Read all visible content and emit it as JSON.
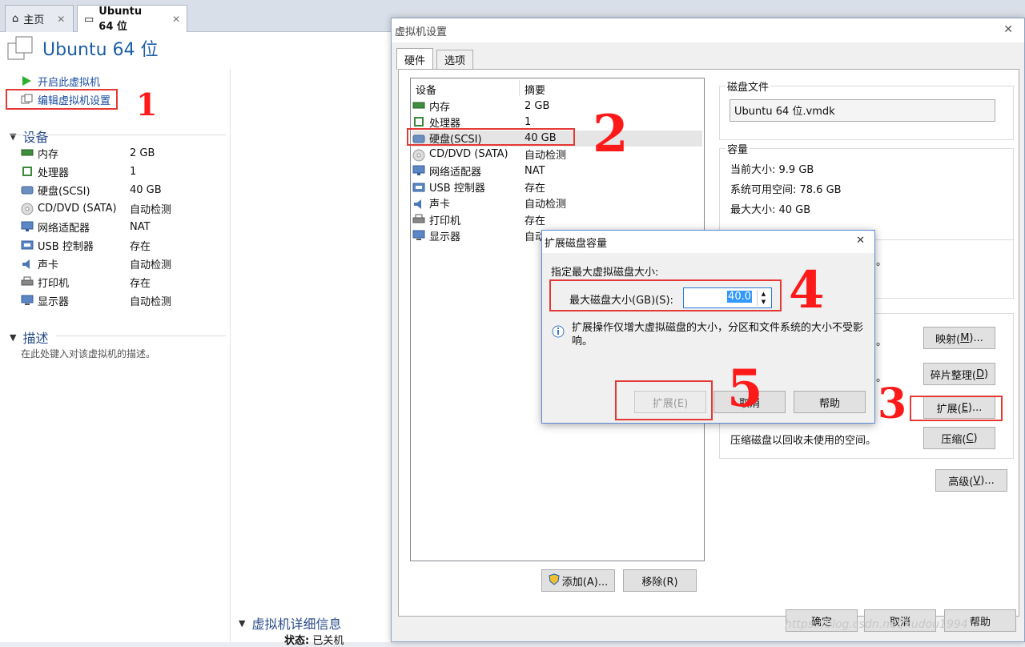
{
  "tabs": [
    {
      "label": "主页",
      "icon": "home-icon",
      "close": "✕"
    },
    {
      "label": "Ubuntu 64 位",
      "icon": "vm-icon",
      "close": "✕"
    }
  ],
  "vm_title": "Ubuntu 64 位",
  "left": {
    "actions": [
      {
        "label": "开启此虚拟机",
        "icon": "play-icon"
      },
      {
        "label": "编辑虚拟机设置",
        "icon": "edit-settings-icon"
      }
    ],
    "devices_section": "设备",
    "devices": [
      {
        "name": "内存",
        "value": "2 GB",
        "icon": "memory-icon"
      },
      {
        "name": "处理器",
        "value": "1",
        "icon": "processor-icon"
      },
      {
        "name": "硬盘(SCSI)",
        "value": "40 GB",
        "icon": "hard-disk-icon"
      },
      {
        "name": "CD/DVD (SATA)",
        "value": "自动检测",
        "icon": "cd-dvd-icon"
      },
      {
        "name": "网络适配器",
        "value": "NAT",
        "icon": "network-icon"
      },
      {
        "name": "USB 控制器",
        "value": "存在",
        "icon": "usb-icon"
      },
      {
        "name": "声卡",
        "value": "自动检测",
        "icon": "sound-icon"
      },
      {
        "name": "打印机",
        "value": "存在",
        "icon": "printer-icon"
      },
      {
        "name": "显示器",
        "value": "自动检测",
        "icon": "display-icon"
      }
    ],
    "desc_section": "描述",
    "desc_placeholder": "在此处键入对该虚拟机的描述。",
    "details_section": "虚拟机详细信息",
    "status_label": "状态:",
    "status_value": "已关机"
  },
  "settings": {
    "title": "虚拟机设置",
    "close": "✕",
    "tabs": [
      "硬件",
      "选项"
    ],
    "col_device": "设备",
    "col_summary": "摘要",
    "devices": [
      {
        "name": "内存",
        "value": "2 GB",
        "icon": "memory-icon"
      },
      {
        "name": "处理器",
        "value": "1",
        "icon": "processor-icon"
      },
      {
        "name": "硬盘(SCSI)",
        "value": "40 GB",
        "icon": "hard-disk-icon"
      },
      {
        "name": "CD/DVD (SATA)",
        "value": "自动检测",
        "icon": "cd-dvd-icon"
      },
      {
        "name": "网络适配器",
        "value": "NAT",
        "icon": "network-icon"
      },
      {
        "name": "USB 控制器",
        "value": "存在",
        "icon": "usb-icon"
      },
      {
        "name": "声卡",
        "value": "自动检测",
        "icon": "sound-icon"
      },
      {
        "name": "打印机",
        "value": "存在",
        "icon": "printer-icon"
      },
      {
        "name": "显示器",
        "value": "自动检",
        "icon": "display-icon"
      }
    ],
    "add_label": "添加(A)...",
    "remove_label": "移除(R)",
    "disk_file_title": "磁盘文件",
    "disk_file_value": "Ubuntu 64 位.vmdk",
    "capacity_title": "容量",
    "current_size": "当前大小: 9.9 GB",
    "free_space": "系统可用空间: 78.6 GB",
    "max_size": "最大大小: 40 GB",
    "dot1": "。",
    "dot2": "。",
    "dot3": "。",
    "map_btn": "映射(M)...",
    "defrag_btn": "碎片整理(D)",
    "expand_btn": "扩展(E)...",
    "compact_text": "压缩磁盘以回收未使用的空间。",
    "compact_btn": "压缩(C)",
    "advanced_btn": "高级(V)...",
    "ok_btn": "确定",
    "cancel_btn": "取消",
    "help_btn": "帮助"
  },
  "expand": {
    "title": "扩展磁盘容量",
    "close": "✕",
    "prompt": "指定最大虚拟磁盘大小:",
    "field_label": "最大磁盘大小(GB)(S):",
    "field_value": "40.0",
    "info": "扩展操作仅增大虚拟磁盘的大小，分区和文件系统的大小不受影响。",
    "expand_btn": "扩展(E)",
    "cancel_btn": "取消",
    "help_btn": "帮助"
  },
  "annotations": [
    "1",
    "2",
    "3",
    "4",
    "5"
  ],
  "watermark": "https://blog.csdn.net/kudou1994"
}
